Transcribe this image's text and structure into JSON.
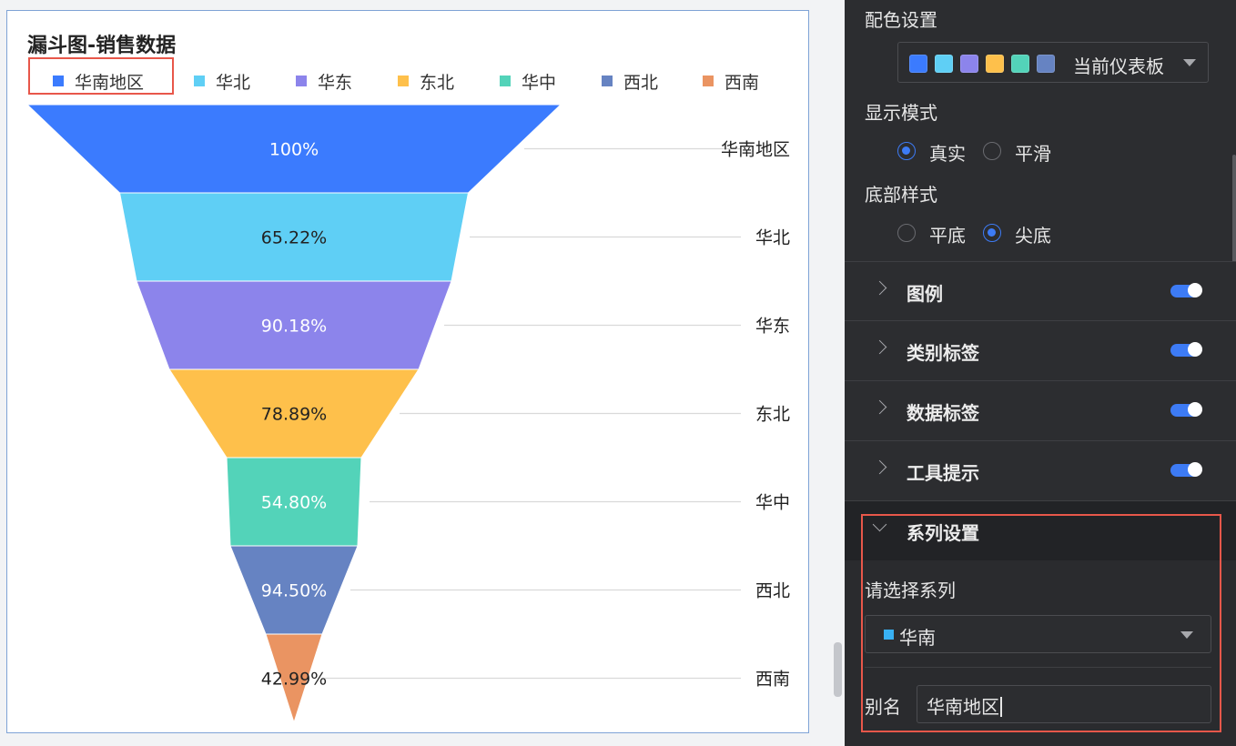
{
  "chart": {
    "title": "漏斗图-销售数据",
    "legend": [
      {
        "label": "华南地区",
        "color": "#3b7bfe"
      },
      {
        "label": "华北",
        "color": "#5fcff5"
      },
      {
        "label": "华东",
        "color": "#8c84eb"
      },
      {
        "label": "东北",
        "color": "#fec04b"
      },
      {
        "label": "华中",
        "color": "#53d3b9"
      },
      {
        "label": "西北",
        "color": "#6683c2"
      },
      {
        "label": "西南",
        "color": "#ea9462"
      }
    ]
  },
  "chart_data": {
    "type": "funnel",
    "title": "漏斗图-销售数据",
    "categories": [
      "华南地区",
      "华北",
      "华东",
      "东北",
      "华中",
      "西北",
      "西南"
    ],
    "data_labels": [
      "100%",
      "65.22%",
      "90.18%",
      "78.89%",
      "54.80%",
      "94.50%",
      "42.99%"
    ],
    "conversion_percent": [
      100,
      65.22,
      90.18,
      78.89,
      54.8,
      94.5,
      42.99
    ],
    "colors": [
      "#3b7bfe",
      "#5fcff5",
      "#8c84eb",
      "#fec04b",
      "#53d3b9",
      "#6683c2",
      "#ea9462"
    ],
    "label_colors": [
      "#ffffff",
      "#222222",
      "#ffffff",
      "#222222",
      "#ffffff",
      "#ffffff",
      "#222222"
    ],
    "legend_position": "top-left",
    "bottom_style": "pointed"
  },
  "panel": {
    "color_settings": {
      "label": "配色设置",
      "swatches": [
        "#3b7bfe",
        "#5fcff5",
        "#8c84eb",
        "#fec04b",
        "#53d3b9",
        "#6683c2"
      ],
      "selected": "当前仪表板"
    },
    "display_mode": {
      "label": "显示模式",
      "options": [
        {
          "label": "真实",
          "checked": true
        },
        {
          "label": "平滑",
          "checked": false
        }
      ]
    },
    "bottom_style": {
      "label": "底部样式",
      "options": [
        {
          "label": "平底",
          "checked": false
        },
        {
          "label": "尖底",
          "checked": true
        }
      ]
    },
    "collapse_rows": [
      {
        "label": "图例",
        "enabled": true
      },
      {
        "label": "类别标签",
        "enabled": true
      },
      {
        "label": "数据标签",
        "enabled": true
      },
      {
        "label": "工具提示",
        "enabled": true
      }
    ],
    "series_settings": {
      "label": "系列设置",
      "select_label": "请选择系列",
      "selected_series": "华南",
      "alias_label": "别名",
      "alias_value": "华南地区"
    }
  }
}
